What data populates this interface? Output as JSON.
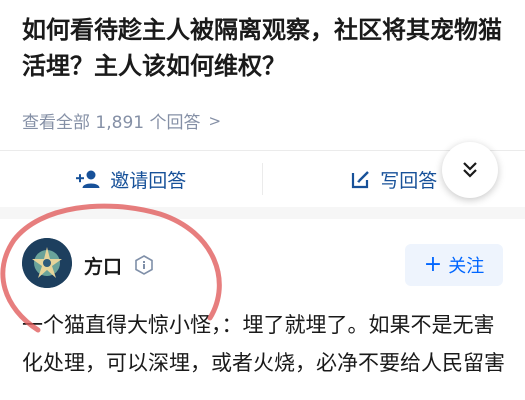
{
  "question": {
    "title": "如何看待趁主人被隔离观察，社区将其宠物猫活埋？主人该如何维权？",
    "answer_count_text": "查看全部 1,891 个回答"
  },
  "actions": {
    "invite_label": "邀请回答",
    "write_label": "写回答"
  },
  "answer": {
    "author_name": "方口",
    "follow_label": "关注",
    "excerpt": "一个猫直得大惊小怪，：埋了就埋了。如果不是无害化处理，可以深埋，或者火烧，必净不要给人民留害"
  },
  "icons": {
    "answers_chevron": "chevron-right-icon",
    "invite": "person-add-icon",
    "write": "edit-icon",
    "expand": "double-chevron-down-icon",
    "badge": "hexagon-badge-icon",
    "follow": "plus-icon"
  },
  "colors": {
    "link_blue": "#175199",
    "follow_blue": "#0066ff",
    "follow_bg": "#eef4fd",
    "meta_gray": "#8590a6",
    "annotation_red": "#e05a5a"
  }
}
